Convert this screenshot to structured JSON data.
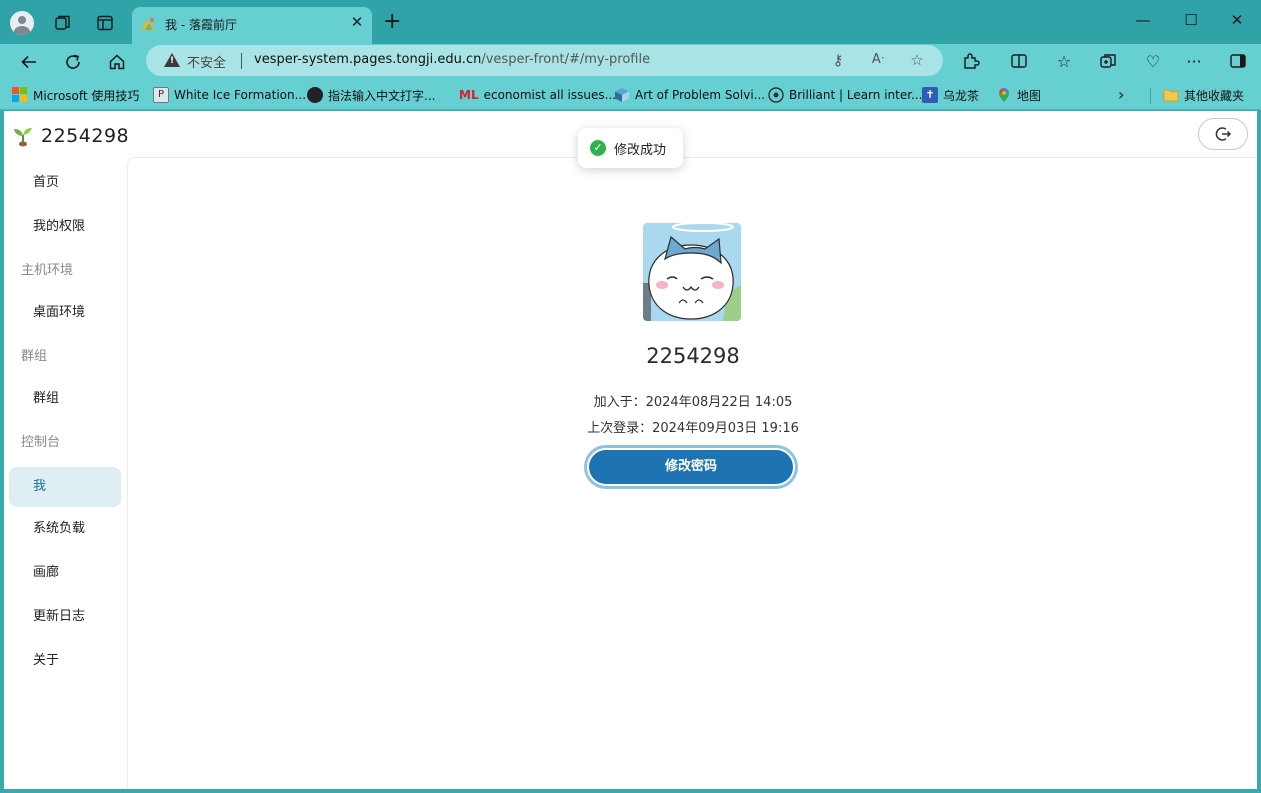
{
  "browser": {
    "tab_title": "我 - 落霞前厅",
    "tab_close": "✕",
    "new_tab": "+",
    "not_secure": "不安全",
    "url_host": "vesper-system.pages.tongji.edu.cn",
    "url_path": "/vesper-front/#/my-profile",
    "window_minimize": "—",
    "window_maximize": "☐",
    "window_close": "✕"
  },
  "bookmarks": [
    {
      "label": "Microsoft 使用技巧",
      "icon": "microsoft-logo-icon"
    },
    {
      "label": "White Ice Formation...",
      "icon": "page-icon"
    },
    {
      "label": "指法输入中文打字...",
      "icon": "typing-icon"
    },
    {
      "label": "economist all issues...",
      "icon": "ml-icon",
      "icon_text": "ML"
    },
    {
      "label": "Art of Problem Solvi...",
      "icon": "cube-icon"
    },
    {
      "label": "Brilliant | Learn inter...",
      "icon": "brilliant-icon"
    },
    {
      "label": "乌龙茶",
      "icon": "tea-icon"
    },
    {
      "label": "地图",
      "icon": "map-pin-icon"
    }
  ],
  "bookmarks_more": "›",
  "other_favorites": "其他收藏夹",
  "app": {
    "title": "2254298",
    "logout_icon": "⏻"
  },
  "sidebar": {
    "items": [
      {
        "type": "item",
        "label": "首页"
      },
      {
        "type": "item",
        "label": "我的权限"
      },
      {
        "type": "group",
        "label": "主机环境"
      },
      {
        "type": "item",
        "label": "桌面环境"
      },
      {
        "type": "group",
        "label": "群组"
      },
      {
        "type": "item",
        "label": "群组"
      },
      {
        "type": "group",
        "label": "控制台"
      },
      {
        "type": "item",
        "label": "我",
        "active": true
      },
      {
        "type": "item",
        "label": "系统负载"
      },
      {
        "type": "item",
        "label": "画廊"
      },
      {
        "type": "item",
        "label": "更新日志"
      },
      {
        "type": "item",
        "label": "关于"
      }
    ]
  },
  "profile": {
    "username": "2254298",
    "joined": "加入于：2024年08月22日 14:05",
    "last_login": "上次登录：2024年09月03日 19:16",
    "change_password": "修改密码"
  },
  "toast": {
    "icon": "✓",
    "message": "修改成功"
  },
  "colors": {
    "frame": "#2fa3a8",
    "toolbar": "#66cfd2",
    "accent": "#1e73b3",
    "active_nav_bg": "#dfeef2",
    "success": "#2fb24b"
  }
}
